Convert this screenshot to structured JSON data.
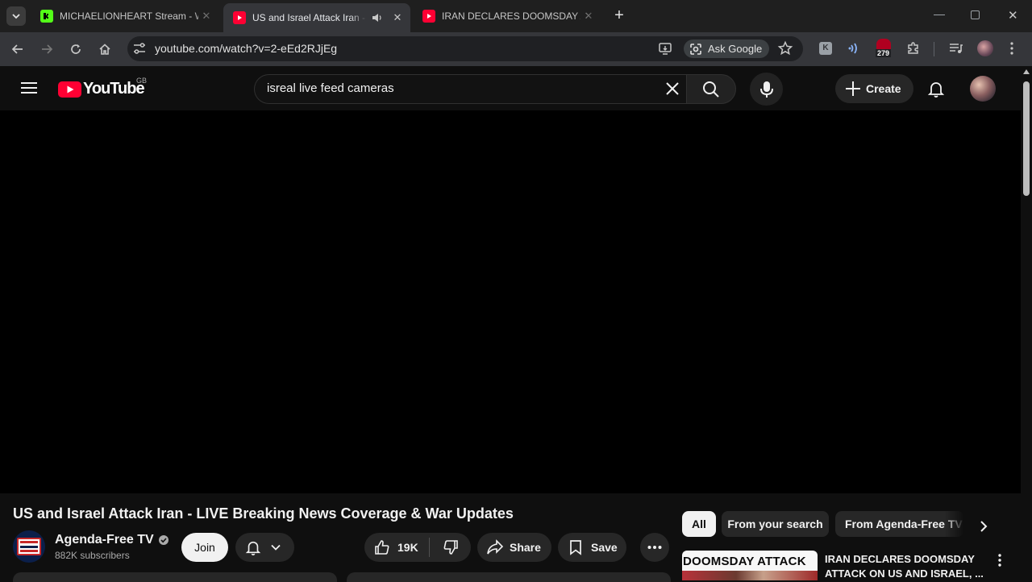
{
  "browser": {
    "tabs": [
      {
        "title": "MICHAELIONHEART Stream - W",
        "favicon_color": "#53fc18",
        "active": false
      },
      {
        "title": "US and Israel Attack Iran - L",
        "favicon_color": "#ff0033",
        "active": true,
        "audio": true
      },
      {
        "title": "IRAN DECLARES DOOMSDAY A",
        "favicon_color": "#ff0033",
        "active": false
      }
    ],
    "url": "youtube.com/watch?v=2-eEd2RJjEg",
    "ask_google_label": "Ask Google",
    "extension_badge": "279"
  },
  "youtube": {
    "logo_text": "YouTube",
    "region": "GB",
    "search_query": "isreal live feed cameras",
    "create_label": "Create"
  },
  "video": {
    "title": "US and Israel Attack Iran - LIVE Breaking News Coverage & War Updates",
    "channel_name": "Agenda-Free TV",
    "subscribers": "882K subscribers",
    "join_label": "Join",
    "likes": "19K",
    "share_label": "Share",
    "save_label": "Save"
  },
  "sidebar": {
    "chips": [
      "All",
      "From your search",
      "From Agenda-Free TV"
    ],
    "recommended": {
      "thumb_text": "DOOMSDAY ATTACK",
      "title_line1": "IRAN DECLARES DOOMSDAY",
      "title_line2": "ATTACK ON US AND ISRAEL, ..."
    }
  },
  "colors": {
    "youtube_red": "#ff0033",
    "kick_green": "#53fc18"
  }
}
